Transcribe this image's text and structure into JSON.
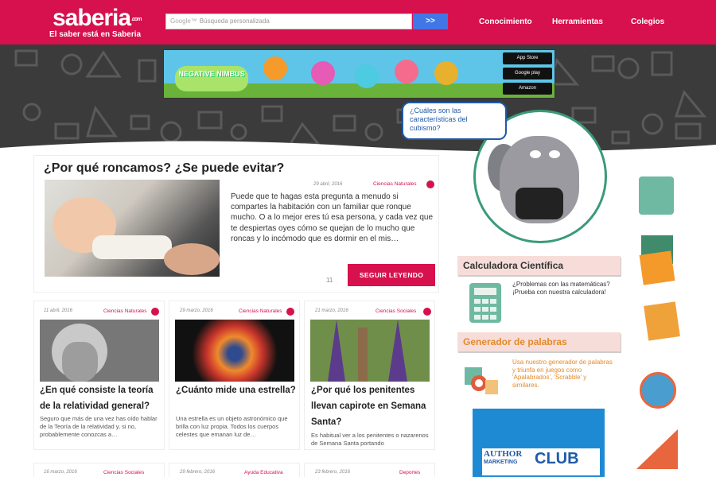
{
  "header": {
    "logo": "saberia",
    "logo_suffix": ".com",
    "slogan": "El saber está en Saberia",
    "search_brand": "Google™",
    "search_placeholder": "Búsqueda personalizada",
    "search_button": ">>",
    "nav": [
      "Conocimiento",
      "Herramientas",
      "Colegios"
    ],
    "color": "#d6114d"
  },
  "banner": {
    "title": "NEGATIVE NIMBUS",
    "store1": "App Store",
    "store2": "Google play",
    "store3": "Amazon"
  },
  "mascot": {
    "question": "¿Cuáles son las características del cubismo?"
  },
  "featured": {
    "title": "¿Por qué roncamos? ¿Se puede evitar?",
    "date": "29 abril, 2016",
    "category": "Ciencias Naturales",
    "excerpt": "Puede que te hagas esta pregunta a menudo si compartes la habitación con un familiar que ronque mucho. O a lo mejor eres tú esa persona, y cada vez que te despiertas oyes cómo se quejan de lo mucho que roncas y lo incómodo que es dormir en el mis…",
    "count": "11",
    "button": "SEGUIR LEYENDO"
  },
  "cards": [
    {
      "date": "11 abril, 2016",
      "category": "Ciencias Naturales",
      "title": "¿En qué consiste la teoría de la relatividad general?",
      "excerpt": "Seguro que más de una vez has oído hablar de la Teoría de la relatividad y, si no, probablemente conozcas a…"
    },
    {
      "date": "29 marzo, 2016",
      "category": "Ciencias Naturales",
      "title": "¿Cuánto mide una estrella?",
      "excerpt": "Una estrella es un objeto astronómico que brilla con luz propia. Todos los cuerpos celestes que emanan luz de…"
    },
    {
      "date": "21 marzo, 2016",
      "category": "Ciencias Sociales",
      "title": "¿Por qué los penitentes llevan capirote en Semana Santa?",
      "excerpt": "Es habitual ver a los penitentes o nazarenos de Semana Santa portando"
    }
  ],
  "cards_row2": [
    {
      "date": "16 marzo, 2016",
      "category": "Ciencias Sociales"
    },
    {
      "date": "29 febrero, 2016",
      "category": "Ayuda Educativa"
    },
    {
      "date": "23 febrero, 2016",
      "category": "Deportes"
    }
  ],
  "sidebar": {
    "calc_title": "Calculadora Científica",
    "calc_text": "¿Problemas con las matemáticas? ¡Prueba con nuestra calculadora!",
    "gen_title": "Generador de palabras",
    "gen_text": "Usa nuestro generador de palabras y triunfa en juegos como 'Apalabrados', 'Scrabble' y similares.",
    "ad_line1": "AUTHOR",
    "ad_line2": "MARKETING",
    "ad_line3": "CLUB"
  }
}
